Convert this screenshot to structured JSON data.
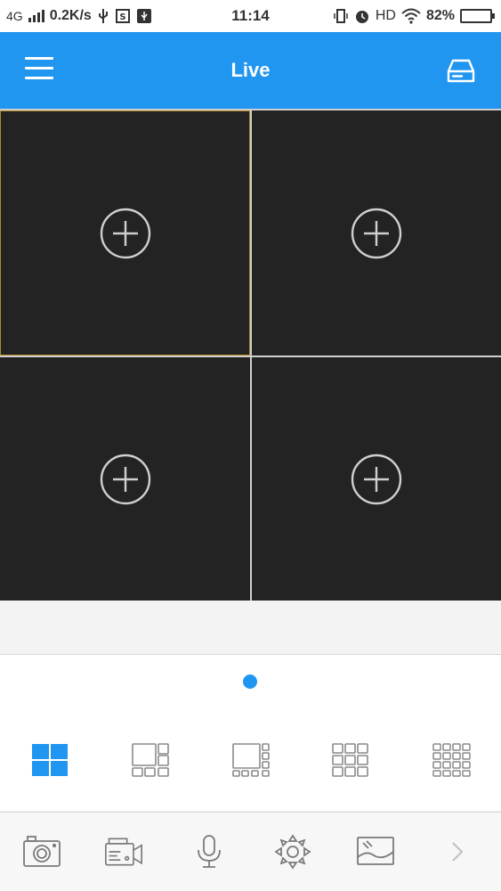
{
  "status": {
    "network": "4G",
    "speed": "0.2K/s",
    "time": "11:14",
    "hd": "HD",
    "battery": "82%"
  },
  "appbar": {
    "title": "Live",
    "menu_icon": "hamburger-menu-icon",
    "right_icon": "storage-drive-icon"
  },
  "live_grid": {
    "cells": [
      {
        "icon": "add-channel-icon",
        "selected": true
      },
      {
        "icon": "add-channel-icon",
        "selected": false
      },
      {
        "icon": "add-channel-icon",
        "selected": false
      },
      {
        "icon": "add-channel-icon",
        "selected": false
      }
    ]
  },
  "pager": {
    "pages": 1,
    "current": 1
  },
  "layouts": [
    {
      "name": "1x4",
      "active": true
    },
    {
      "name": "1+5",
      "active": false
    },
    {
      "name": "1+7",
      "active": false
    },
    {
      "name": "3x3",
      "active": false
    },
    {
      "name": "4x4",
      "active": false
    }
  ],
  "toolbar": [
    "snapshot-icon",
    "record-icon",
    "microphone-icon",
    "ptz-icon",
    "image-adjust-icon",
    "chevron-right-icon"
  ],
  "colors": {
    "accent": "#2196f0",
    "cell": "#232323",
    "selected_border": "#b38a28"
  }
}
